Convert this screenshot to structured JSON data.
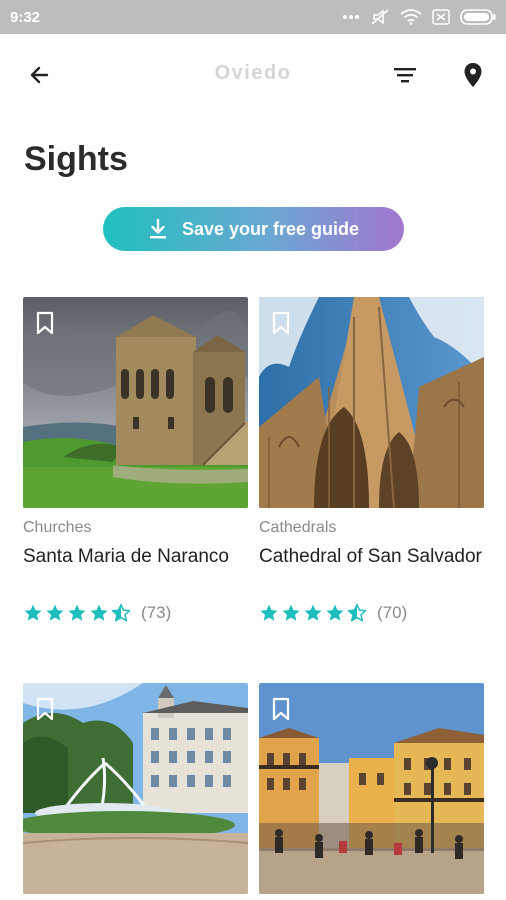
{
  "status_bar": {
    "time": "9:32"
  },
  "header": {
    "title": "Oviedo"
  },
  "page": {
    "title": "Sights"
  },
  "save_button": {
    "label": "Save your free guide"
  },
  "colors": {
    "accent": "#1fbdbd",
    "gradient_end": "#a276cf",
    "star": "#1fbdbd"
  },
  "sights": [
    {
      "category": "Churches",
      "name": "Santa Maria de Naranco",
      "rating": 4.5,
      "reviews": "(73)"
    },
    {
      "category": "Cathedrals",
      "name": "Cathedral of San Salvador",
      "rating": 4.5,
      "reviews": "(70)"
    },
    {
      "category": "",
      "name": "",
      "rating": null,
      "reviews": ""
    },
    {
      "category": "",
      "name": "",
      "rating": null,
      "reviews": ""
    }
  ]
}
